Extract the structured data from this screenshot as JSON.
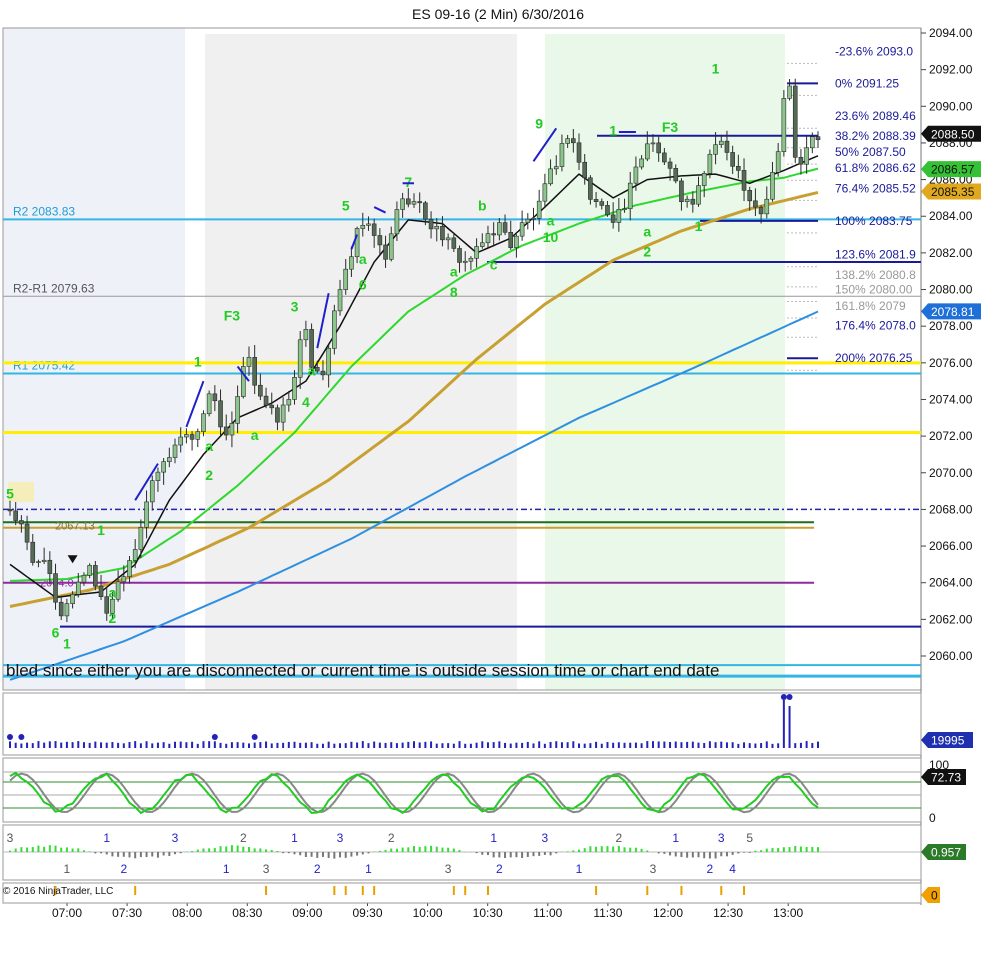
{
  "title": "ES 09-16 (2 Min)  6/30/2016",
  "copyright": "© 2016 NinjaTrader, LLC",
  "disconnected_message": "bled since either you are disconnected or current time is outside session time or chart end date",
  "colors": {
    "candle_up": "#8bc58b",
    "candle_down": "#556b55",
    "ema_fast": "#111111",
    "ema_mid": "#2ed82e",
    "ema_slow": "#c8a032",
    "ema_long": "#2f8fe0",
    "fib_line": "#1a1a99",
    "pivot_line": "#33b5e5",
    "yellow_line": "#ffee00",
    "green_line": "#1d6e1d",
    "magenta_line": "#8e2a9e",
    "stoch_green": "#22cc22",
    "stoch_gray": "#888888",
    "wave_green": "#22cc22",
    "wave_blue": "#1f1fcc"
  },
  "chart_data": {
    "type": "candlestick",
    "title": "ES 09-16 (2 Min)  6/30/2016",
    "y_range": [
      2058.6,
      2094.6
    ],
    "y_ticks": [
      "2094.00",
      "2092.00",
      "2090.00",
      "2088.00",
      "2086.00",
      "2084.00",
      "2082.00",
      "2080.00",
      "2078.00",
      "2076.00",
      "2074.00",
      "2072.00",
      "2070.00",
      "2068.00",
      "2066.00",
      "2064.00",
      "2062.00",
      "2060.00"
    ],
    "x_ticks": [
      "07:00",
      "07:30",
      "08:00",
      "08:30",
      "09:00",
      "09:30",
      "10:00",
      "10:30",
      "11:00",
      "11:30",
      "12:00",
      "12:30",
      "13:00"
    ],
    "price_path": [
      [
        0,
        2068
      ],
      [
        2,
        2067
      ],
      [
        4,
        2065
      ],
      [
        6,
        2065.5
      ],
      [
        8,
        2062.8
      ],
      [
        9,
        2062
      ],
      [
        10,
        2063
      ],
      [
        12,
        2064
      ],
      [
        14,
        2065
      ],
      [
        16,
        2063
      ],
      [
        17,
        2062.5
      ],
      [
        19,
        2064
      ],
      [
        22,
        2066
      ],
      [
        24,
        2068.5
      ],
      [
        26,
        2070
      ],
      [
        28,
        2071
      ],
      [
        30,
        2072
      ],
      [
        32,
        2072
      ],
      [
        34,
        2073
      ],
      [
        35,
        2074.5
      ],
      [
        36,
        2074
      ],
      [
        37,
        2072.5
      ],
      [
        38,
        2071.8
      ],
      [
        39,
        2072.5
      ],
      [
        41,
        2075.5
      ],
      [
        42,
        2076.5
      ],
      [
        43,
        2075
      ],
      [
        45,
        2073.5
      ],
      [
        47,
        2073
      ],
      [
        49,
        2074
      ],
      [
        50,
        2075.5
      ],
      [
        51,
        2077
      ],
      [
        52,
        2077.5
      ],
      [
        53,
        2076
      ],
      [
        55,
        2075.5
      ],
      [
        56,
        2077
      ],
      [
        58,
        2080
      ],
      [
        60,
        2082
      ],
      [
        61,
        2083
      ],
      [
        62,
        2083.5
      ],
      [
        64,
        2083
      ],
      [
        66,
        2081.5
      ],
      [
        68,
        2084.5
      ],
      [
        70,
        2085
      ],
      [
        72,
        2084.5
      ],
      [
        74,
        2083.5
      ],
      [
        76,
        2083
      ],
      [
        78,
        2082
      ],
      [
        80,
        2081.5
      ],
      [
        82,
        2082
      ],
      [
        84,
        2083
      ],
      [
        86,
        2083.5
      ],
      [
        88,
        2082.5
      ],
      [
        90,
        2083.5
      ],
      [
        92,
        2084
      ],
      [
        93,
        2084.5
      ],
      [
        94,
        2085.5
      ],
      [
        96,
        2087
      ],
      [
        98,
        2088.5
      ],
      [
        99,
        2088
      ],
      [
        100,
        2087
      ],
      [
        102,
        2085
      ],
      [
        104,
        2084.5
      ],
      [
        106,
        2084
      ],
      [
        108,
        2084.5
      ],
      [
        110,
        2086.5
      ],
      [
        112,
        2088
      ],
      [
        113,
        2088.3
      ],
      [
        114,
        2087.5
      ],
      [
        116,
        2086.5
      ],
      [
        118,
        2085
      ],
      [
        120,
        2084.5
      ],
      [
        122,
        2086.5
      ],
      [
        124,
        2088
      ],
      [
        126,
        2087.5
      ],
      [
        128,
        2086.5
      ],
      [
        130,
        2085
      ],
      [
        132,
        2084.2
      ],
      [
        133,
        2085
      ],
      [
        135,
        2087.5
      ],
      [
        136,
        2090.5
      ],
      [
        137,
        2091
      ],
      [
        138,
        2087.5
      ],
      [
        139,
        2087
      ],
      [
        140,
        2088
      ],
      [
        141,
        2088.3
      ],
      [
        142,
        2088.5
      ]
    ],
    "ema_fast": [
      [
        0,
        2065
      ],
      [
        8,
        2063.2
      ],
      [
        16,
        2063.5
      ],
      [
        22,
        2065
      ],
      [
        28,
        2068.5
      ],
      [
        34,
        2071
      ],
      [
        40,
        2073
      ],
      [
        46,
        2073.8
      ],
      [
        52,
        2075
      ],
      [
        58,
        2078
      ],
      [
        64,
        2081.5
      ],
      [
        70,
        2083.8
      ],
      [
        76,
        2083.6
      ],
      [
        82,
        2082
      ],
      [
        88,
        2082.8
      ],
      [
        94,
        2084.5
      ],
      [
        100,
        2086.3
      ],
      [
        106,
        2085
      ],
      [
        112,
        2086
      ],
      [
        118,
        2086.2
      ],
      [
        124,
        2086.3
      ],
      [
        130,
        2085.8
      ],
      [
        136,
        2086.5
      ],
      [
        142,
        2087.3
      ]
    ],
    "ema_mid": [
      [
        0,
        2064.1
      ],
      [
        10,
        2064.2
      ],
      [
        20,
        2064.8
      ],
      [
        30,
        2066.8
      ],
      [
        40,
        2069.3
      ],
      [
        50,
        2072.2
      ],
      [
        60,
        2075.8
      ],
      [
        70,
        2078.8
      ],
      [
        80,
        2080.8
      ],
      [
        90,
        2082.4
      ],
      [
        100,
        2083.6
      ],
      [
        110,
        2084.6
      ],
      [
        120,
        2085.3
      ],
      [
        130,
        2085.9
      ],
      [
        136,
        2086.1
      ],
      [
        142,
        2086.6
      ]
    ],
    "ema_slow": [
      [
        0,
        2062.7
      ],
      [
        14,
        2063.6
      ],
      [
        28,
        2065
      ],
      [
        42,
        2067
      ],
      [
        56,
        2069.6
      ],
      [
        70,
        2072.8
      ],
      [
        82,
        2076.2
      ],
      [
        94,
        2079.2
      ],
      [
        106,
        2081.6
      ],
      [
        118,
        2083.2
      ],
      [
        130,
        2084.4
      ],
      [
        142,
        2085.3
      ]
    ],
    "ema_long": [
      [
        0,
        2058.7
      ],
      [
        20,
        2060.8
      ],
      [
        40,
        2063.5
      ],
      [
        60,
        2066.4
      ],
      [
        80,
        2069.8
      ],
      [
        100,
        2073
      ],
      [
        120,
        2075.7
      ],
      [
        142,
        2078.8
      ]
    ],
    "price_labels": [
      {
        "value": 2088.5,
        "label": "2088.50"
      },
      {
        "value": 2086.57,
        "label": "2086.57"
      },
      {
        "value": 2085.35,
        "label": "2085.35"
      },
      {
        "value": 2078.81,
        "label": "2078.81"
      }
    ],
    "pivots": [
      {
        "label": "R2 2083.83",
        "value": 2083.83
      },
      {
        "label": "R2-R1 2079.63",
        "value": 2079.63
      },
      {
        "label": "R1 2075.42",
        "value": 2075.42
      }
    ],
    "yellow_levels": [
      2076.0,
      2072.2
    ],
    "fib_levels": [
      {
        "label": "-23.6%  2093.0",
        "value": 2093.0
      },
      {
        "label": "0%  2091.25",
        "value": 2091.25
      },
      {
        "label": "23.6%  2089.46",
        "value": 2089.46
      },
      {
        "label": "38.2%  2088.39",
        "value": 2088.39
      },
      {
        "label": "50%  2087.50",
        "value": 2087.5
      },
      {
        "label": "61.8%  2086.62",
        "value": 2086.62
      },
      {
        "label": "76.4%  2085.52",
        "value": 2085.52
      },
      {
        "label": "100%  2083.75",
        "value": 2083.75
      },
      {
        "label": "123.6%  2081.9",
        "value": 2081.9
      },
      {
        "label": "138.2%  2080.8",
        "value": 2080.8
      },
      {
        "label": "150%  2080.00",
        "value": 2080.0
      },
      {
        "label": "161.8%  2079",
        "value": 2079.1
      },
      {
        "label": "176.4%  2078.0",
        "value": 2078.05
      },
      {
        "label": "200%  2076.25",
        "value": 2076.25
      }
    ],
    "left_levels": [
      {
        "label": "2067.13",
        "value": 2067.13
      },
      {
        "label": "2064.0",
        "value": 2064.0
      }
    ],
    "wave_labels": [
      {
        "t": 0,
        "v": 2068.6,
        "text": "5"
      },
      {
        "t": 8,
        "v": 2061.0,
        "text": "6"
      },
      {
        "t": 10,
        "v": 2060.4,
        "text": "1"
      },
      {
        "t": 16,
        "v": 2066.6,
        "text": "1"
      },
      {
        "t": 18,
        "v": 2063.2,
        "text": "a"
      },
      {
        "t": 18,
        "v": 2061.8,
        "text": "2"
      },
      {
        "t": 35,
        "v": 2071.2,
        "text": "a"
      },
      {
        "t": 35,
        "v": 2069.6,
        "text": "2"
      },
      {
        "t": 33,
        "v": 2075.8,
        "text": "1"
      },
      {
        "t": 39,
        "v": 2078.3,
        "text": "F3"
      },
      {
        "t": 43,
        "v": 2071.8,
        "text": "a"
      },
      {
        "t": 52,
        "v": 2073.6,
        "text": "4"
      },
      {
        "t": 53,
        "v": 2075.3,
        "text": "a"
      },
      {
        "t": 50,
        "v": 2078.8,
        "text": "3"
      },
      {
        "t": 59,
        "v": 2084.3,
        "text": "5"
      },
      {
        "t": 62,
        "v": 2081.4,
        "text": "a"
      },
      {
        "t": 62,
        "v": 2080.0,
        "text": "6"
      },
      {
        "t": 70,
        "v": 2085.6,
        "text": "7"
      },
      {
        "t": 78,
        "v": 2080.7,
        "text": "a"
      },
      {
        "t": 78,
        "v": 2079.6,
        "text": "8"
      },
      {
        "t": 83,
        "v": 2084.3,
        "text": "b"
      },
      {
        "t": 85,
        "v": 2081.1,
        "text": "c"
      },
      {
        "t": 93,
        "v": 2088.8,
        "text": "9"
      },
      {
        "t": 95,
        "v": 2083.5,
        "text": "a"
      },
      {
        "t": 95,
        "v": 2082.6,
        "text": "10"
      },
      {
        "t": 106,
        "v": 2088.4,
        "text": "1"
      },
      {
        "t": 112,
        "v": 2082.9,
        "text": "a"
      },
      {
        "t": 112,
        "v": 2081.8,
        "text": "2"
      },
      {
        "t": 116,
        "v": 2088.6,
        "text": "F3"
      },
      {
        "t": 121,
        "v": 2083.2,
        "text": "1"
      },
      {
        "t": 124,
        "v": 2091.8,
        "text": "1"
      }
    ],
    "volume_label": "19995",
    "stochastic": {
      "label": "72.73",
      "ticks": [
        "100",
        "0"
      ]
    },
    "macd_label": "0.957",
    "macd_waves": [
      {
        "t": 0,
        "text": "3"
      },
      {
        "t": 17,
        "text": "1"
      },
      {
        "t": 29,
        "text": "3"
      },
      {
        "t": 41,
        "text": "2"
      },
      {
        "t": 50,
        "text": "1"
      },
      {
        "t": 58,
        "text": "3"
      },
      {
        "t": 67,
        "text": "2"
      },
      {
        "t": 85,
        "text": "1"
      },
      {
        "t": 94,
        "text": "3"
      },
      {
        "t": 107,
        "text": "2"
      },
      {
        "t": 117,
        "text": "1"
      },
      {
        "t": 125,
        "text": "3"
      },
      {
        "t": 130,
        "text": "5"
      },
      {
        "t": 20,
        "text": "2"
      },
      {
        "t": 38,
        "text": "1"
      },
      {
        "t": 45,
        "text": "3"
      },
      {
        "t": 54,
        "text": "2"
      },
      {
        "t": 63,
        "text": "1"
      },
      {
        "t": 77,
        "text": "3"
      },
      {
        "t": 86,
        "text": "2"
      },
      {
        "t": 100,
        "text": "1"
      },
      {
        "t": 113,
        "text": "3"
      },
      {
        "t": 123,
        "text": "2"
      },
      {
        "t": 127,
        "text": "4"
      },
      {
        "t": 10,
        "text": "1"
      }
    ],
    "bottom_label": "0"
  }
}
